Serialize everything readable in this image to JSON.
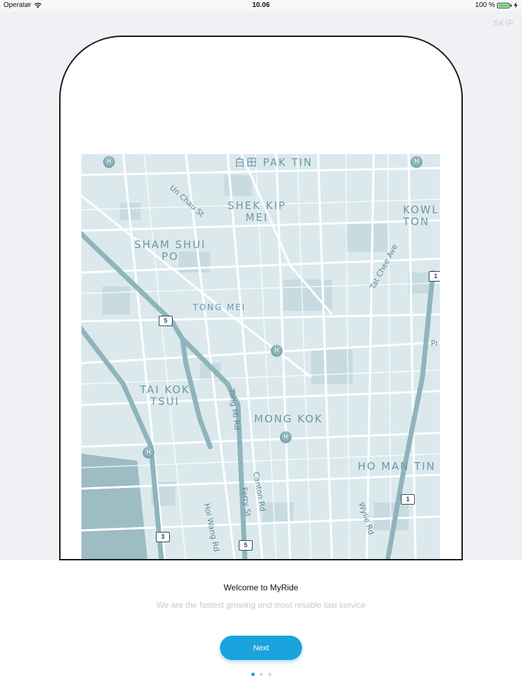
{
  "status_bar": {
    "carrier": "Operatør",
    "time": "10.06",
    "battery": "100 %",
    "battery_level": 1.0
  },
  "onboarding": {
    "skip_label": "SKIP",
    "title": "Welcome to MyRide",
    "subtitle": "We are the fastest growing and most reliable taxi service",
    "next_label": "Next",
    "page_count": 3,
    "current_page": 1
  },
  "map": {
    "districts": {
      "pak_tin": "白田 PAK TIN",
      "shek_kip_mei": "SHEK KIP\nMEI",
      "sham_shui_po": "SHAM SHUI\nPO",
      "kowloon_tong": "KOWL\nTON",
      "tong_mei": "TONG MEI",
      "tai_kok_tsui": "TAI KOK\nTSUI",
      "mong_kok": "MONG KOK",
      "ho_man_tin": "HO MAN TIN"
    },
    "streets": {
      "un_chau_st": "Un Chau St",
      "tat_chee_ave": "Tat Chee Ave",
      "tong_mi_rd": "Tong Mi Rd",
      "canton_rd": "Canton Rd",
      "ferry_st": "Ferry St",
      "hoi_wang_rd": "Hoi Wang Rd",
      "wylie_rd": "Wylie Rd",
      "pr_partial": "Pr"
    },
    "routes": {
      "r5_top": "5",
      "r5_bottom": "5",
      "r1_right": "1",
      "r1_bottom": "1",
      "r3": "3"
    },
    "icons": [
      "mtr-station-icon"
    ]
  },
  "colors": {
    "accent": "#1aa3dc",
    "map_water": "#9dbcc4",
    "map_land": "#dbe9ed",
    "map_road": "#ffffff"
  }
}
